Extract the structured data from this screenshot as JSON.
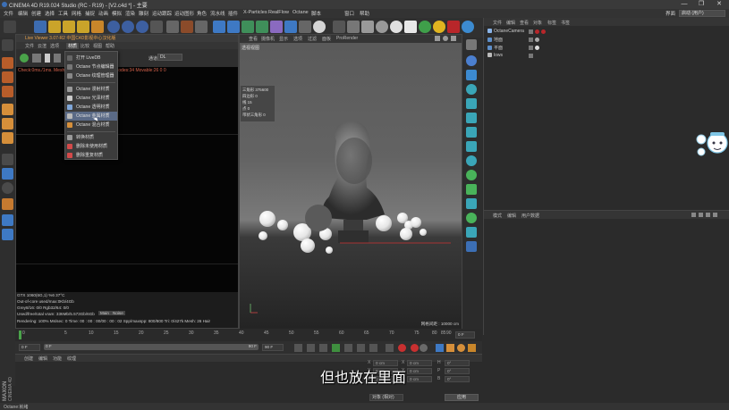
{
  "window": {
    "title": "CINEMA 4D R19.024 Studio (RC - R19) - [V2.c4d *] - 主要",
    "min": "—",
    "max": "❐",
    "close": "✕"
  },
  "menubar": {
    "items": [
      "文件",
      "编辑",
      "创建",
      "选择",
      "工具",
      "网格",
      "捕捉",
      "动画",
      "模拟",
      "渲染",
      "雕刻",
      "运动跟踪",
      "运动图形",
      "角色",
      "流水线",
      "插件",
      "X-Particles",
      "RealFlow",
      "Octane",
      "脚本",
      "窗口",
      "帮助"
    ],
    "layout_label": "界面",
    "layout_value": "启动 (用户)"
  },
  "liveviewer": {
    "title": "Live Viewer 3.07-R2 中国C4D影视中心汉化版",
    "menu": [
      "文件",
      "云渲",
      "选项",
      "材质",
      "比较",
      "视图",
      "帮助",
      "帮助"
    ],
    "info": "Check:0ms./1ms. MeshGen:0ms Update[C]:0ms Nodes:34 Movable:26 0 0",
    "pt_label": "通道",
    "pt_value": "DL",
    "stats": [
      "GTX 1060(6G,1)    %6     37°C",
      "Out-of-core used/max:0Kb/4Gb",
      "Grey8/16: 0/0        Rgb32/64: 0/0",
      "Used/free/total vram: 336Mb/5.573Gb/6Gb",
      "Rendering: 100%  Ms/sec: 0  Time: 00 : 00 : 00/00 : 00 : 02  Spp/maxspp: 800/800  Tri: 0/427k  Mesh: 26  Hair"
    ],
    "stats_btn1": "Main",
    "stats_btn2": "Noise"
  },
  "dropdown": {
    "items": [
      {
        "label": "打开 LiveDB",
        "color": "#666"
      },
      {
        "label": "Octane 节点编辑器",
        "color": "#777"
      },
      {
        "label": "Octane 纹理管理器",
        "color": "#888"
      },
      {
        "label": "Octane 漫射材质",
        "color": "#9a9a9a"
      },
      {
        "label": "Octane 光泽材质",
        "color": "#c9c9c9"
      },
      {
        "label": "Octane 透明材质",
        "color": "#7fa6d8"
      },
      {
        "label": "Octane 金属材质",
        "color": "#b9b9b9"
      },
      {
        "label": "Octane 混合材质",
        "color": "#d68f3a"
      },
      {
        "label": "转换材质",
        "color": "#999"
      },
      {
        "label": "删除未使用材质",
        "color": "#d34a4a"
      },
      {
        "label": "删除重复材质",
        "color": "#d34a4a"
      }
    ]
  },
  "viewport": {
    "menu": [
      "查看",
      "摄像机",
      "显示",
      "选项",
      "过滤",
      "面板",
      "ProRender"
    ],
    "label": "透视视图",
    "stats": [
      {
        "k": "三角形",
        "v": "375600"
      },
      {
        "k": "四边形",
        "v": "0"
      },
      {
        "k": "线",
        "v": "15"
      },
      {
        "k": "点",
        "v": "0"
      },
      {
        "k": "带状三角形",
        "v": "0"
      }
    ],
    "grid": "网格间距 : 10000 cm"
  },
  "objects": {
    "menu": [
      "文件",
      "编辑",
      "查看",
      "对象",
      "标签",
      "书签"
    ],
    "rows": [
      {
        "label": "OctaneCamera",
        "color": "#8ab4e8"
      },
      {
        "label": "地面",
        "color": "#5e8fc9"
      },
      {
        "label": "平面",
        "color": "#5e8fc9"
      },
      {
        "label": "lows",
        "color": "#bbb"
      }
    ]
  },
  "attributes": {
    "menu": [
      "模式",
      "编辑",
      "用户数据"
    ]
  },
  "timeline": {
    "ticks": [
      "0",
      "5",
      "10",
      "15",
      "20",
      "25",
      "30",
      "35",
      "40",
      "45",
      "50",
      "55",
      "60",
      "65",
      "70",
      "75",
      "80",
      "85",
      "90"
    ],
    "start": "0 F",
    "end": "90 F",
    "current": "0 F",
    "range_start": "0 F",
    "range_end": "90 F"
  },
  "materials": {
    "menu": [
      "创建",
      "编辑",
      "功能",
      "纹理"
    ]
  },
  "coordinates": {
    "labels": [
      "X",
      "Y",
      "Z",
      "X",
      "Y",
      "Z",
      "H",
      "P",
      "B"
    ],
    "values": [
      "0 cm",
      "0 cm",
      "0 cm",
      "0 cm",
      "0 cm",
      "0 cm",
      "0°",
      "0°",
      "0°"
    ],
    "mode": "对象 (相对)",
    "apply": "应用"
  },
  "status": "Octane:就绪",
  "subtitle": "但也放在里面",
  "maxon": [
    "MAXON",
    "CINEMA 4D"
  ]
}
